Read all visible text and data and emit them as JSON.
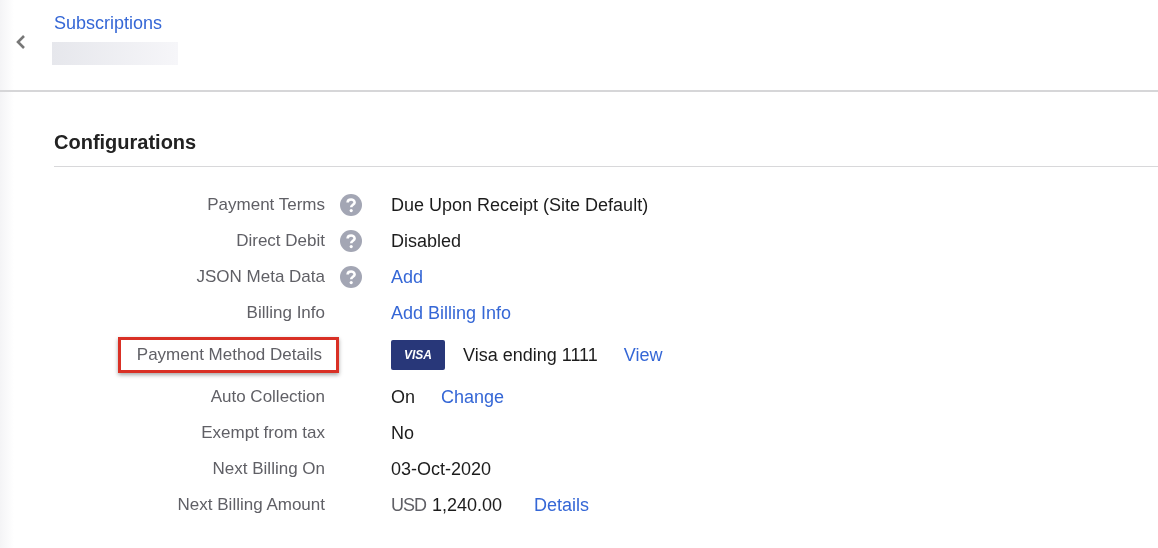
{
  "header": {
    "breadcrumb": "Subscriptions"
  },
  "section": {
    "title": "Configurations"
  },
  "rows": [
    {
      "label": "Payment Terms",
      "help": true,
      "highlighted": false,
      "parts": [
        {
          "kind": "text",
          "text": "Due Upon Receipt (Site Default)"
        }
      ]
    },
    {
      "label": "Direct Debit",
      "help": true,
      "highlighted": false,
      "parts": [
        {
          "kind": "text",
          "text": "Disabled"
        }
      ]
    },
    {
      "label": "JSON Meta Data",
      "help": true,
      "highlighted": false,
      "parts": [
        {
          "kind": "link",
          "text": "Add"
        }
      ]
    },
    {
      "label": "Billing Info",
      "help": false,
      "highlighted": false,
      "parts": [
        {
          "kind": "link",
          "text": "Add Billing Info"
        }
      ]
    },
    {
      "label": "Payment Method Details",
      "help": false,
      "highlighted": true,
      "parts": [
        {
          "kind": "card",
          "text": "VISA"
        },
        {
          "kind": "text",
          "text": "Visa ending 1111"
        },
        {
          "kind": "link",
          "text": "View"
        }
      ]
    },
    {
      "label": "Auto Collection",
      "help": false,
      "highlighted": false,
      "parts": [
        {
          "kind": "text",
          "text": "On"
        },
        {
          "kind": "link",
          "text": "Change"
        }
      ]
    },
    {
      "label": "Exempt from tax",
      "help": false,
      "highlighted": false,
      "parts": [
        {
          "kind": "text",
          "text": "No"
        }
      ]
    },
    {
      "label": "Next Billing On",
      "help": false,
      "highlighted": false,
      "parts": [
        {
          "kind": "text",
          "text": "03-Oct-2020"
        }
      ]
    },
    {
      "label": "Next Billing Amount",
      "help": false,
      "highlighted": false,
      "parts": [
        {
          "kind": "currency",
          "text": "USD"
        },
        {
          "kind": "amount",
          "text": "1,240.00"
        },
        {
          "kind": "link",
          "text": "Details"
        }
      ]
    }
  ]
}
